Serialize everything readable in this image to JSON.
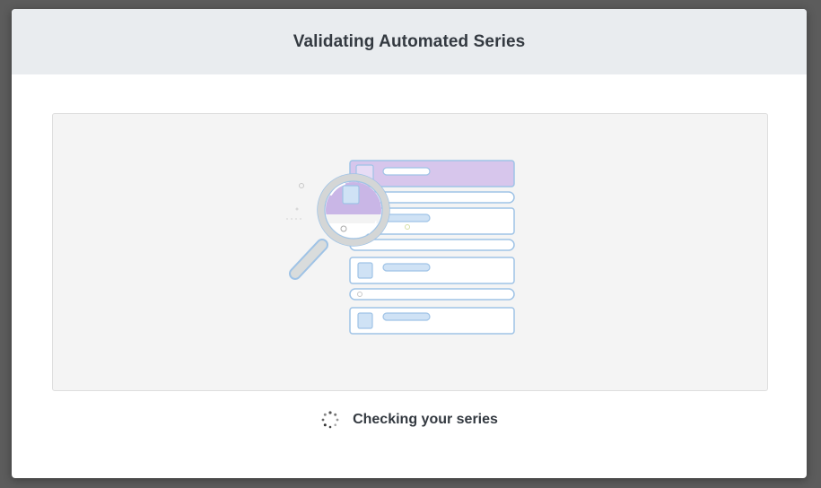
{
  "dialog": {
    "title": "Validating Automated Series"
  },
  "illustration": {
    "icon": "magnifier-over-list-icon"
  },
  "status": {
    "icon": "loading-spinner-icon",
    "text": "Checking your series"
  },
  "colors": {
    "header_bg": "#e9ecef",
    "panel_bg": "#f4f4f4",
    "row_outline": "#9fc3e6",
    "row_fill": "#ffffff",
    "highlight_row_fill": "#d7c6ec",
    "thumb_fill": "#cfe2f5",
    "lens_ring": "#d4d6d6",
    "handle": "#d9dcdc"
  }
}
